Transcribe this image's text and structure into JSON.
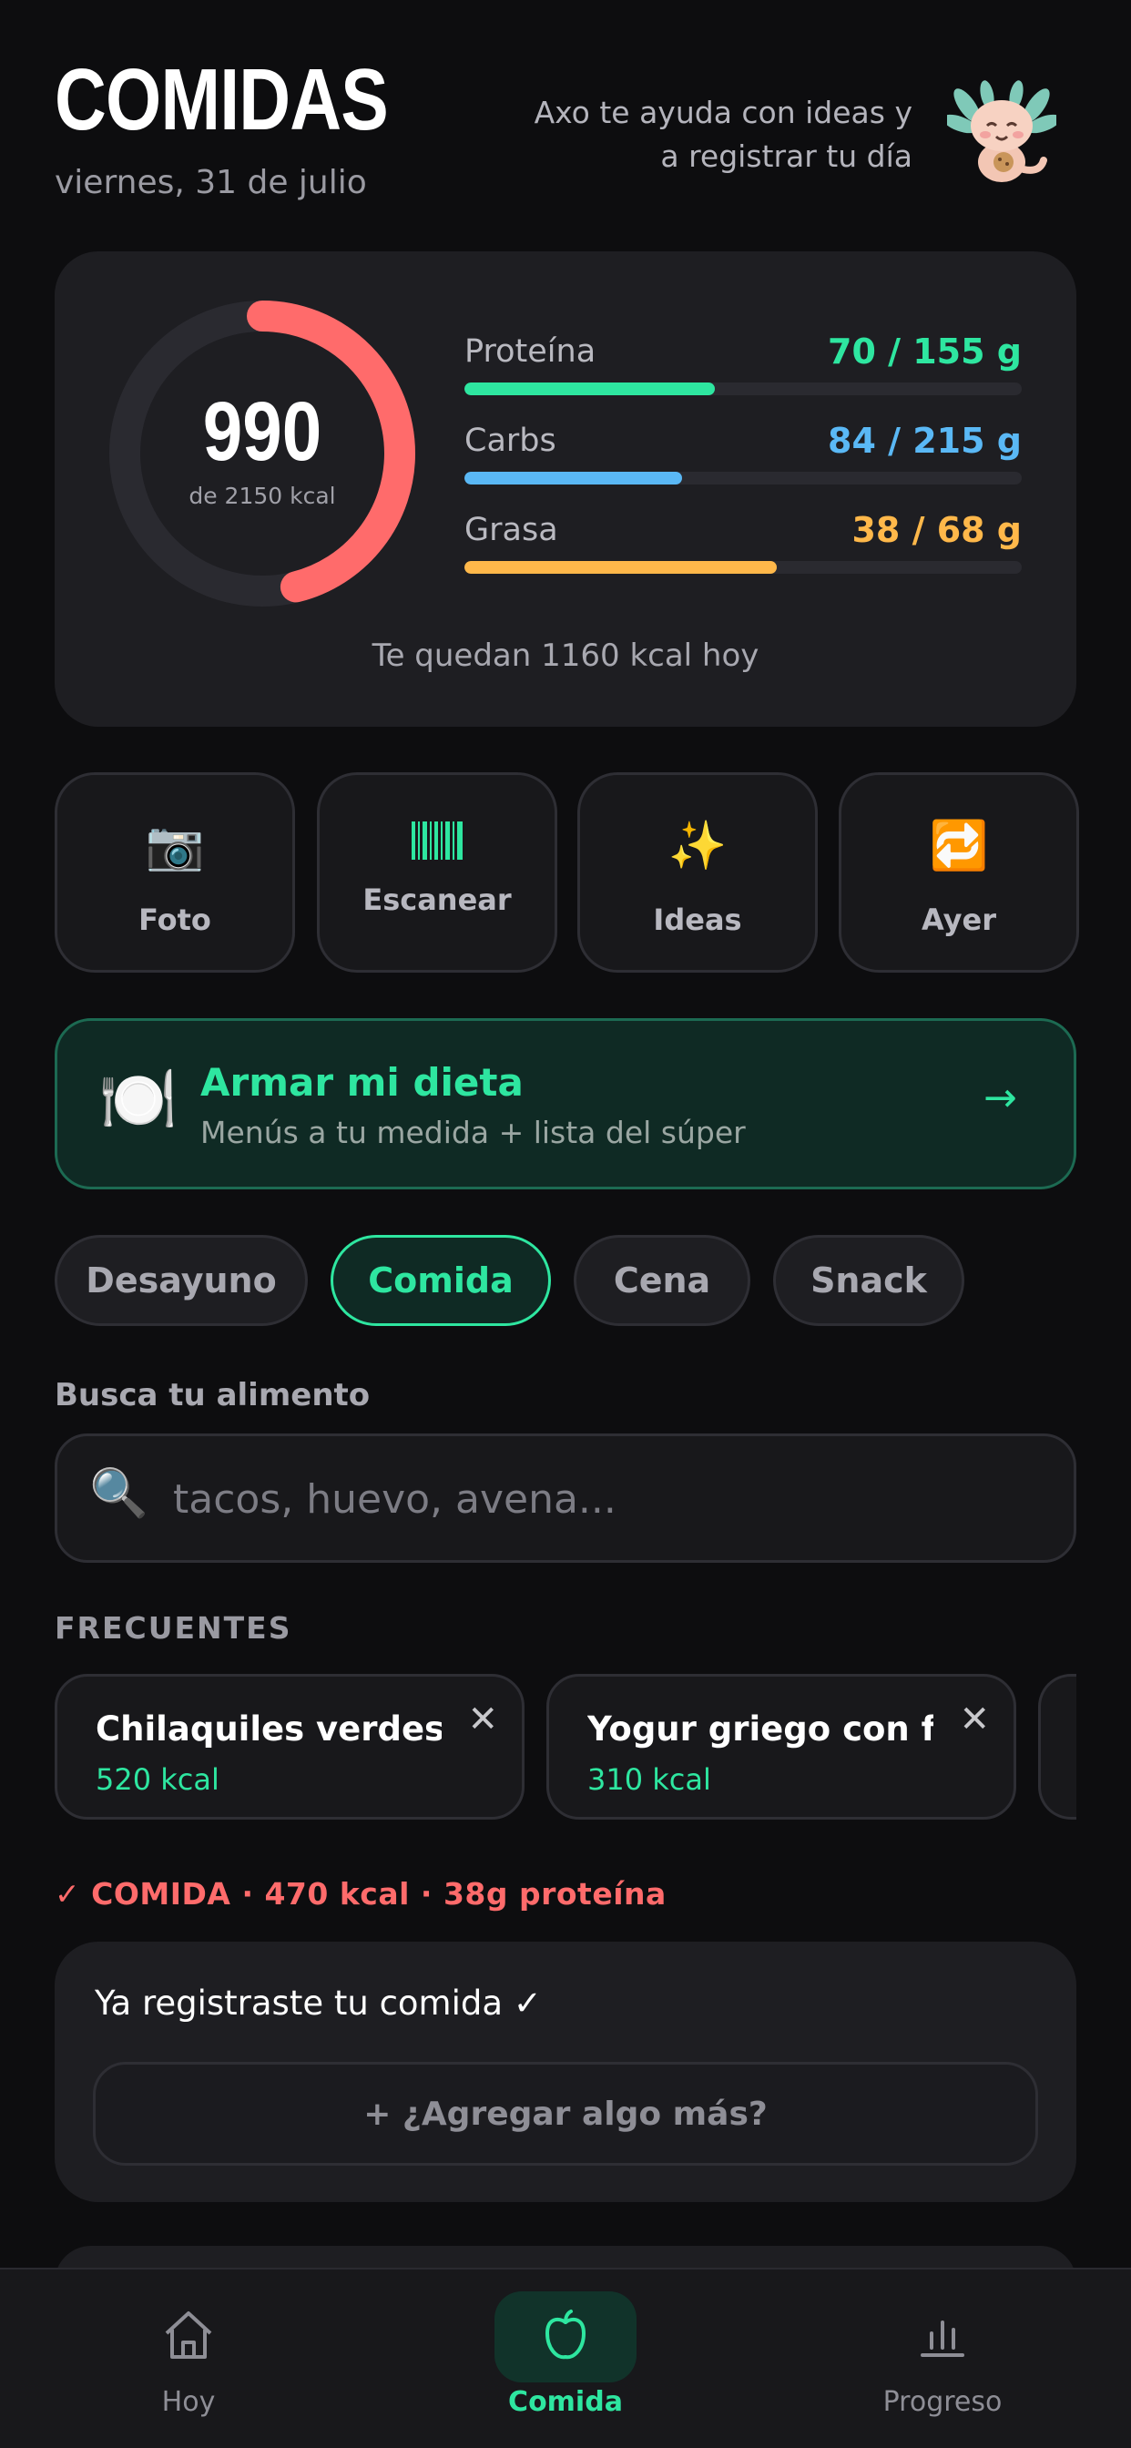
{
  "header": {
    "title": "COMIDAS",
    "date": "viernes, 31 de julio",
    "helper_line1": "Axo te ayuda con ideas y",
    "helper_line2": "a registrar tu día",
    "avatar_icon": "axolotl-mascot"
  },
  "summary": {
    "calories": "990",
    "calories_sub": "de 2150 kcal",
    "calories_consumed": 990,
    "calories_goal": 2150,
    "remaining": "Te quedan 1160 kcal hoy",
    "macros": [
      {
        "label": "Proteína",
        "value": "70 / 155 g",
        "fraction": 0.45,
        "color": "#2ee6a0"
      },
      {
        "label": "Carbs",
        "value": "84 / 215 g",
        "fraction": 0.39,
        "color": "#5ab8f5"
      },
      {
        "label": "Grasa",
        "value": "38 / 68 g",
        "fraction": 0.56,
        "color": "#ffb84a"
      }
    ],
    "ring_color": "#ff6b6b"
  },
  "quick_actions": [
    {
      "label": "Foto",
      "icon": "📷",
      "icon_name": "camera-icon"
    },
    {
      "label": "Escanear",
      "icon": "barcode",
      "icon_name": "barcode-icon"
    },
    {
      "label": "Ideas",
      "icon": "✨",
      "icon_name": "sparkles-icon"
    },
    {
      "label": "Ayer",
      "icon": "🔁",
      "icon_name": "repeat-icon"
    }
  ],
  "plan": {
    "icon": "🍽️",
    "title": "Armar mi dieta",
    "subtitle": "Menús a tu medida + lista del súper",
    "arrow": "→"
  },
  "meals": {
    "tabs": [
      "Desayuno",
      "Comida",
      "Cena",
      "Snack"
    ],
    "active": "Comida"
  },
  "search": {
    "label": "Busca tu alimento",
    "icon": "🔍",
    "placeholder": "tacos, huevo, avena..."
  },
  "frequent": {
    "heading": "FRECUENTES",
    "items": [
      {
        "name": "Chilaquiles verdes c...",
        "kcal": "520 kcal"
      },
      {
        "name": "Yogur griego con fre...",
        "kcal": "310 kcal"
      }
    ],
    "remove_icon": "✕"
  },
  "logged": {
    "heading": "✓ COMIDA · 470 kcal · 38g proteína",
    "message": "Ya registraste tu comida ✓",
    "add_more": "+ ¿Agregar algo más?"
  },
  "nav": {
    "items": [
      {
        "label": "Hoy",
        "icon": "home-icon"
      },
      {
        "label": "Comida",
        "icon": "apple-icon"
      },
      {
        "label": "Progreso",
        "icon": "bar-chart-icon"
      }
    ],
    "active": "Comida",
    "active_color": "#2ee6a0"
  }
}
